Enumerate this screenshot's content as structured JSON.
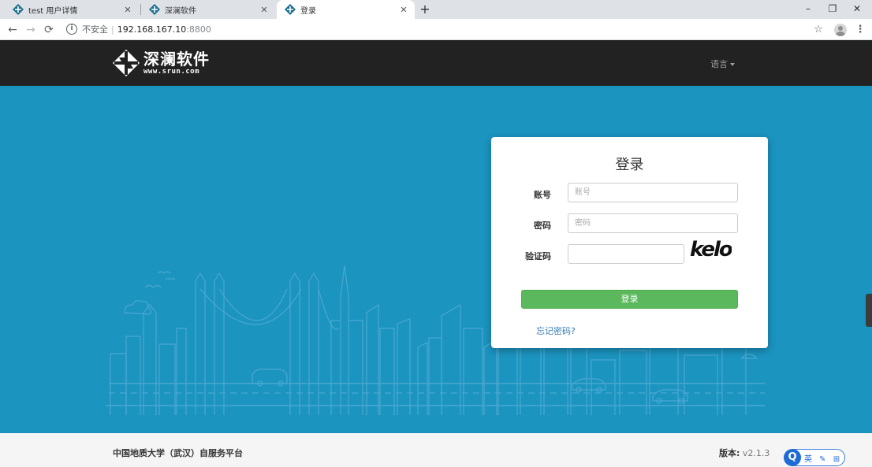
{
  "browser": {
    "tabs": [
      {
        "label": "test 用户详情",
        "active": false
      },
      {
        "label": "深澜软件",
        "active": false
      },
      {
        "label": "登录",
        "active": true
      }
    ],
    "new_tab": "+",
    "window_controls": {
      "minimize": "–",
      "restore": "❐",
      "close": "✕"
    },
    "nav": {
      "back": "←",
      "forward": "→",
      "reload": "⟳"
    },
    "address": {
      "security": "不安全",
      "host": "192.168.167.10",
      "port": ":8800"
    },
    "star": "☆",
    "menu": "⋮"
  },
  "header": {
    "logo_text": "深澜软件",
    "logo_url": "www.srun.com",
    "language": "语言"
  },
  "login": {
    "title": "登录",
    "account_label": "账号",
    "account_placeholder": "账号",
    "password_label": "密码",
    "password_placeholder": "密码",
    "captcha_label": "验证码",
    "captcha_text": "kelo",
    "submit": "登录",
    "forgot": "忘记密码?"
  },
  "footer": {
    "org": "中国地质大学（武汉）自服务平台",
    "version_label": "版本:",
    "version_value": "v2.1.3"
  },
  "ime": {
    "logo": "Q",
    "text": "英 ✎ ⊞"
  },
  "colors": {
    "hero_bg": "#1b94c0",
    "header_bg": "#222222",
    "button_green": "#5cb85c",
    "link_blue": "#337ab7"
  }
}
